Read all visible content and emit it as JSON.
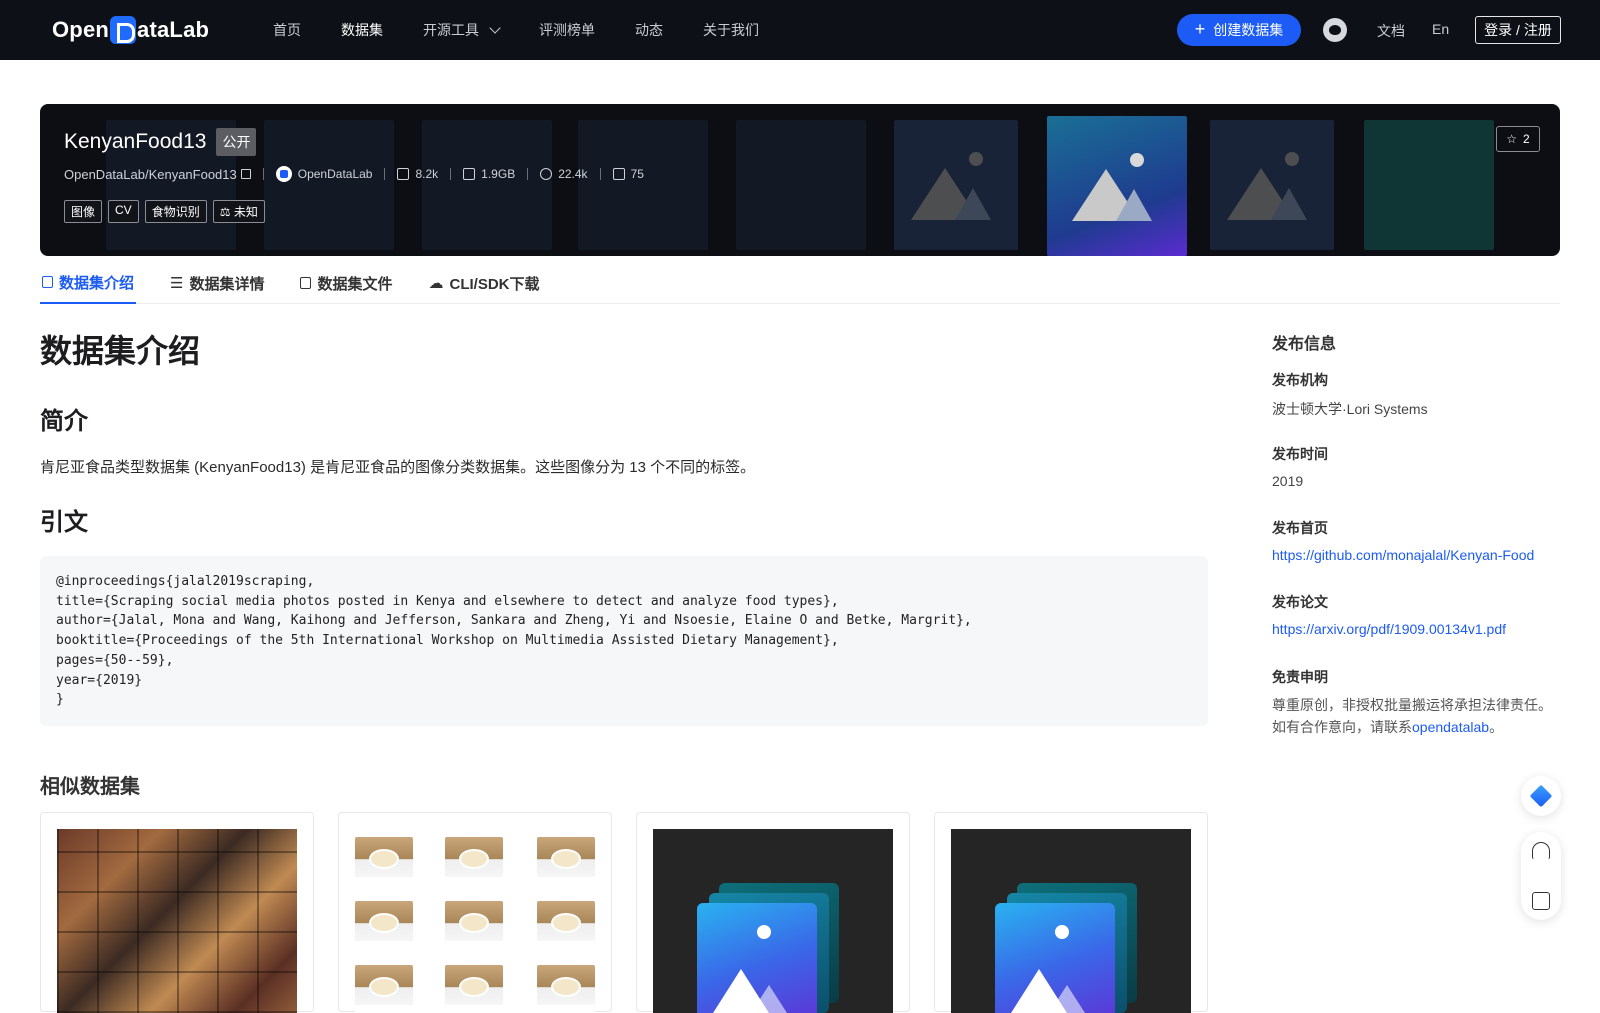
{
  "header": {
    "logo": "OpenDataLab",
    "nav": [
      "首页",
      "数据集",
      "开源工具",
      "评测榜单",
      "动态",
      "关于我们"
    ],
    "create_label": "创建数据集",
    "docs": "文档",
    "lang": "En",
    "login": "登录 / 注册"
  },
  "dataset": {
    "name": "KenyanFood13",
    "visibility": "公开",
    "path": "OpenDataLab/KenyanFood13",
    "org": "OpenDataLab",
    "files": "8.2k",
    "size": "1.9GB",
    "views": "22.4k",
    "downloads": "75",
    "tags": [
      "图像",
      "CV",
      "食物识别"
    ],
    "license": "未知",
    "stars": "2"
  },
  "tabs": [
    "数据集介绍",
    "数据集详情",
    "数据集文件",
    "CLI/SDK下载"
  ],
  "content": {
    "title": "数据集介绍",
    "intro_heading": "简介",
    "intro_text": "肯尼亚食品类型数据集 (KenyanFood13) 是肯尼亚食品的图像分类数据集。这些图像分为 13 个不同的标签。",
    "citation_heading": "引文",
    "citation": "@inproceedings{jalal2019scraping,\ntitle={Scraping social media photos posted in Kenya and elsewhere to detect and analyze food types},\nauthor={Jalal, Mona and Wang, Kaihong and Jefferson, Sankara and Zheng, Yi and Nsoesie, Elaine O and Betke, Margrit},\nbooktitle={Proceedings of the 5th International Workshop on Multimedia Assisted Dietary Management},\npages={50--59},\nyear={2019}\n}",
    "similar_heading": "相似数据集"
  },
  "sidebar": {
    "title": "发布信息",
    "org_label": "发布机构",
    "org_value": "波士顿大学·Lori Systems",
    "time_label": "发布时间",
    "time_value": "2019",
    "home_label": "发布首页",
    "home_value": "https://github.com/monajalal/Kenyan-Food",
    "paper_label": "发布论文",
    "paper_value": "https://arxiv.org/pdf/1909.00134v1.pdf",
    "disclaimer_label": "免责申明",
    "disclaimer_line1": "尊重原创，非授权批量搬运将承担法律责任。",
    "disclaimer_line2_prefix": "如有合作意向，请联系",
    "disclaimer_link": "opendatalab",
    "disclaimer_suffix": "。"
  },
  "icons": {
    "create": "plus-icon",
    "github": "github-icon",
    "star": "star-icon",
    "float": [
      "diamond-icon",
      "headset-icon",
      "edit-icon"
    ]
  },
  "colors": {
    "accent": "#1c5bf5",
    "header_bg": "#0d1017",
    "banner_bg": "#0c0e13"
  }
}
